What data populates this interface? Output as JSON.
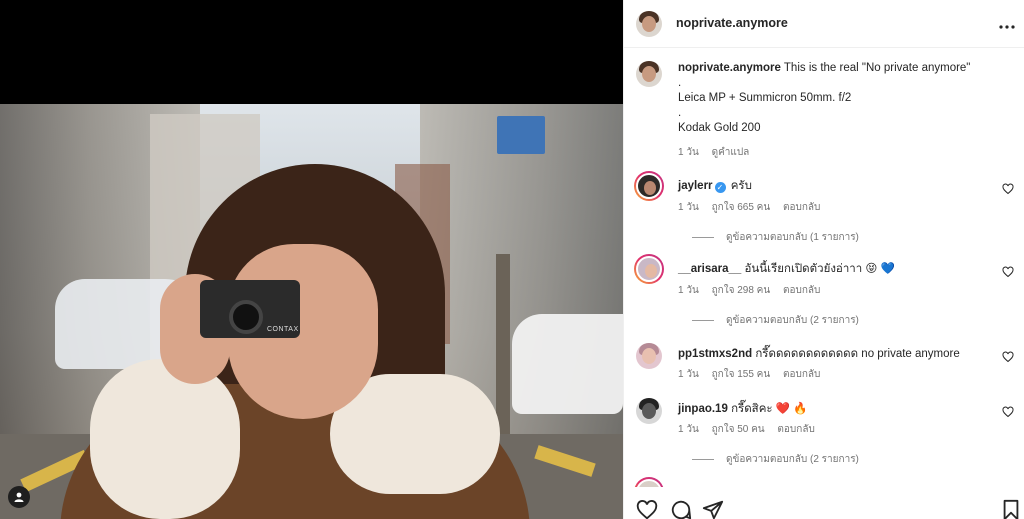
{
  "post": {
    "username": "noprivate.anymore",
    "more_label": "•••",
    "camera_brand": "CONTAX"
  },
  "caption": {
    "username": "noprivate.anymore",
    "line1": "This is the real \"No private anymore\"",
    "line2": ".",
    "line3": "Leica MP + Summicron 50mm. f/2",
    "line4": ".",
    "line5": "Kodak Gold 200",
    "time": "1 วัน",
    "translate": "ดูคำแปล"
  },
  "comments": [
    {
      "username": "jaylerr",
      "verified": true,
      "text": "ครับ",
      "time": "1 วัน",
      "likes": "ถูกใจ 665 คน",
      "reply": "ตอบกลับ",
      "view_replies": "ดูข้อความตอบกลับ (1 รายการ)"
    },
    {
      "username": "__arisara__",
      "text": "อันนี้เรียกเปิดตัวยังอ่าาา 😝 💙",
      "time": "1 วัน",
      "likes": "ถูกใจ 298 คน",
      "reply": "ตอบกลับ",
      "view_replies": "ดูข้อความตอบกลับ (2 รายการ)"
    },
    {
      "username": "pp1stmxs2nd",
      "text": "กรี๊ดดดดดดดดดดดด no private anymore",
      "time": "1 วัน",
      "likes": "ถูกใจ 155 คน",
      "reply": "ตอบกลับ"
    },
    {
      "username": "jinpao.19",
      "text": "กรี๊ดสิคะ ❤️ 🔥",
      "time": "1 วัน",
      "likes": "ถูกใจ 50 คน",
      "reply": "ตอบกลับ",
      "view_replies": "ดูข้อความตอบกลับ (2 รายการ)"
    }
  ],
  "colors": {
    "accent": "#3897f0",
    "text": "#262626",
    "muted": "#737373",
    "like_red": "#ed4956"
  },
  "icons": {
    "heart": "heart-icon",
    "comment": "comment-icon",
    "share": "share-icon",
    "save": "bookmark-icon",
    "user": "user-icon",
    "more": "more-icon"
  }
}
